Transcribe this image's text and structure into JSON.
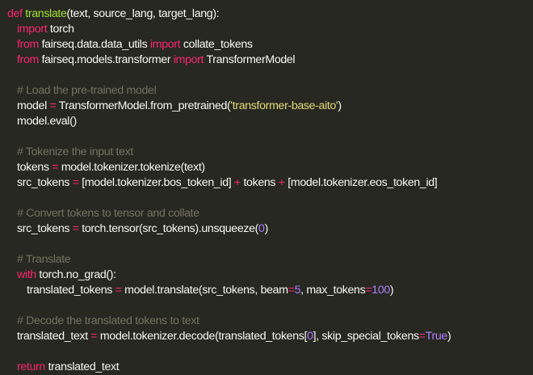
{
  "code": {
    "lines": [
      [
        {
          "t": "kw",
          "v": "def "
        },
        {
          "t": "fn",
          "v": "translate"
        },
        {
          "t": "tx",
          "v": "(text, source_lang, target_lang):"
        }
      ],
      [
        {
          "t": "kw",
          "v": "import "
        },
        {
          "t": "tx",
          "v": "torch"
        }
      ],
      [
        {
          "t": "kw",
          "v": "from "
        },
        {
          "t": "tx",
          "v": "fairseq.data.data_utils "
        },
        {
          "t": "kw",
          "v": "import "
        },
        {
          "t": "tx",
          "v": "collate_tokens"
        }
      ],
      [
        {
          "t": "kw",
          "v": "from "
        },
        {
          "t": "tx",
          "v": "fairseq.models.transformer "
        },
        {
          "t": "kw",
          "v": "import "
        },
        {
          "t": "tx",
          "v": "TransformerModel"
        }
      ],
      [],
      [
        {
          "t": "cm",
          "v": "# Load the pre-trained model"
        }
      ],
      [
        {
          "t": "tx",
          "v": "model "
        },
        {
          "t": "op",
          "v": "="
        },
        {
          "t": "tx",
          "v": " TransformerModel.from_pretrained("
        },
        {
          "t": "str",
          "v": "'transformer-base-aito'"
        },
        {
          "t": "tx",
          "v": ")"
        }
      ],
      [
        {
          "t": "tx",
          "v": "model.eval()"
        }
      ],
      [],
      [
        {
          "t": "cm",
          "v": "# Tokenize the input text"
        }
      ],
      [
        {
          "t": "tx",
          "v": "tokens "
        },
        {
          "t": "op",
          "v": "="
        },
        {
          "t": "tx",
          "v": " model.tokenizer.tokenize(text)"
        }
      ],
      [
        {
          "t": "tx",
          "v": "src_tokens "
        },
        {
          "t": "op",
          "v": "="
        },
        {
          "t": "tx",
          "v": " [model.tokenizer.bos_token_id] "
        },
        {
          "t": "op",
          "v": "+"
        },
        {
          "t": "tx",
          "v": " tokens "
        },
        {
          "t": "op",
          "v": "+"
        },
        {
          "t": "tx",
          "v": " [model.tokenizer.eos_token_id]"
        }
      ],
      [],
      [
        {
          "t": "cm",
          "v": "# Convert tokens to tensor and collate"
        }
      ],
      [
        {
          "t": "tx",
          "v": "src_tokens "
        },
        {
          "t": "op",
          "v": "="
        },
        {
          "t": "tx",
          "v": " torch.tensor(src_tokens).unsqueeze("
        },
        {
          "t": "num",
          "v": "0"
        },
        {
          "t": "tx",
          "v": ")"
        }
      ],
      [],
      [
        {
          "t": "cm",
          "v": "# Translate"
        }
      ],
      [
        {
          "t": "kw",
          "v": "with "
        },
        {
          "t": "tx",
          "v": "torch.no_grad():"
        }
      ],
      [
        {
          "t": "tx",
          "v": "translated_tokens "
        },
        {
          "t": "op",
          "v": "="
        },
        {
          "t": "tx",
          "v": " model.translate(src_tokens, beam"
        },
        {
          "t": "op",
          "v": "="
        },
        {
          "t": "num",
          "v": "5"
        },
        {
          "t": "tx",
          "v": ", max_tokens"
        },
        {
          "t": "op",
          "v": "="
        },
        {
          "t": "num",
          "v": "100"
        },
        {
          "t": "tx",
          "v": ")"
        }
      ],
      [],
      [
        {
          "t": "cm",
          "v": "# Decode the translated tokens to text"
        }
      ],
      [
        {
          "t": "tx",
          "v": "translated_text "
        },
        {
          "t": "op",
          "v": "="
        },
        {
          "t": "tx",
          "v": " model.tokenizer.decode(translated_tokens["
        },
        {
          "t": "num",
          "v": "0"
        },
        {
          "t": "tx",
          "v": "], skip_special_tokens"
        },
        {
          "t": "op",
          "v": "="
        },
        {
          "t": "num",
          "v": "True"
        },
        {
          "t": "tx",
          "v": ")"
        }
      ],
      [],
      [
        {
          "t": "kw",
          "v": "return "
        },
        {
          "t": "tx",
          "v": "translated_text"
        }
      ]
    ]
  },
  "colors": {
    "background": "#272822",
    "keyword": "#f92672",
    "function": "#a6e22e",
    "string": "#e6db74",
    "number": "#ae81ff",
    "comment": "#75715e",
    "text": "#f8f8f2"
  }
}
